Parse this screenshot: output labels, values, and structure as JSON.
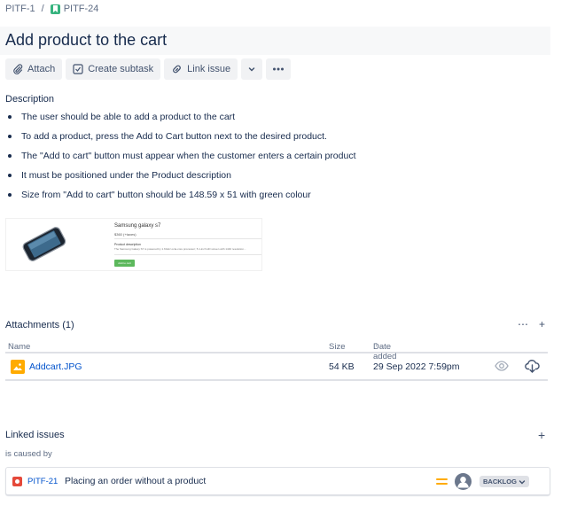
{
  "breadcrumb": {
    "parent": "PITF-1",
    "separator": "/",
    "current": "PITF-24"
  },
  "issue": {
    "title": "Add product to the cart"
  },
  "toolbar": {
    "attach": "Attach",
    "create_subtask": "Create subtask",
    "link_issue": "Link issue"
  },
  "description": {
    "heading": "Description",
    "items": [
      "The user should be able to add a product to the cart",
      "To add a product, press the Add to Cart button next to the desired product.",
      "The \"Add to cart\" button must appear when the customer enters a certain product",
      "It must be positioned under the Product description",
      "Size from \"Add to cart\" button should be 148.59 x 51 with green colour"
    ],
    "thumbnail": {
      "product_title": "Samsung galaxy s7",
      "price": "$360 (+taxes)",
      "desc_label": "Product description",
      "desc_text": "The Samsung Galaxy S7 is powered by 1.6GHz octa-core processor; 5.1-inch HD screen with 1440 resolution...",
      "button": "Add to cart"
    }
  },
  "attachments": {
    "heading": "Attachments (1)",
    "columns": {
      "name": "Name",
      "size": "Size",
      "date": "Date added"
    },
    "sort_glyph": "↕",
    "date_sort_glyph": "↓",
    "rows": [
      {
        "name": "Addcart.JPG",
        "size": "54 KB",
        "date": "29 Sep 2022 7:59pm"
      }
    ]
  },
  "linked": {
    "heading": "Linked issues",
    "relation": "is caused by",
    "issues": [
      {
        "key": "PITF-21",
        "summary": "Placing an order without a product",
        "status": "BACKLOG"
      }
    ]
  },
  "colors": {
    "link": "#0052cc",
    "text": "#172b4d",
    "subtle": "#5e6c84",
    "story": "#36b37e",
    "bug": "#e5493a",
    "priority_medium": "#ffab00"
  }
}
